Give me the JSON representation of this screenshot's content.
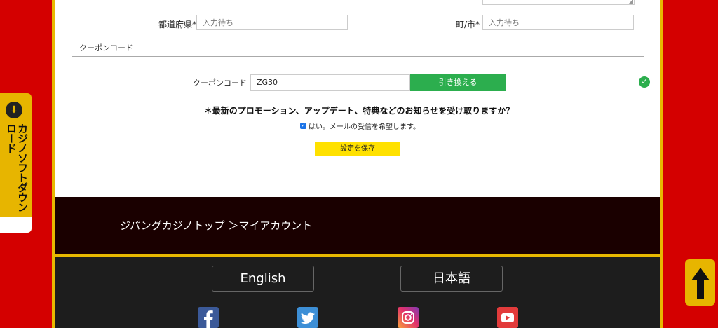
{
  "address": {
    "prefecture_label": "都道府県*",
    "prefecture_placeholder": "入力待ち",
    "city_label": "町/市*",
    "city_placeholder": "入力待ち"
  },
  "coupon": {
    "section_title": "クーポンコード",
    "label": "クーポンコード",
    "value": "ZG30",
    "redeem_label": "引き換える",
    "status_icon": "check-circle-icon"
  },
  "newsletter": {
    "question": "＊最新のプロモーション、アップデート、特典などのお知らせを受け取りますか？",
    "optin_label": "はい。メールの受信を希望します。",
    "optin_checked": true
  },
  "save_label": "設定を保存",
  "breadcrumb": "ジパングカジノトップ ＞マイアカウント",
  "languages": [
    "English",
    "日本語"
  ],
  "social_icons": [
    "facebook-icon",
    "twitter-icon",
    "instagram-icon",
    "youtube-icon"
  ],
  "side_tab": {
    "label": "カジノソフトダウンロード",
    "icon": "download-arrow-icon"
  },
  "back_to_top_icon": "arrow-up-icon",
  "colors": {
    "background_red": "#d40000",
    "gold": "#e8b800",
    "green": "#2cae4e",
    "yellow_button": "#ffe100",
    "dark_band": "#1a0000"
  }
}
